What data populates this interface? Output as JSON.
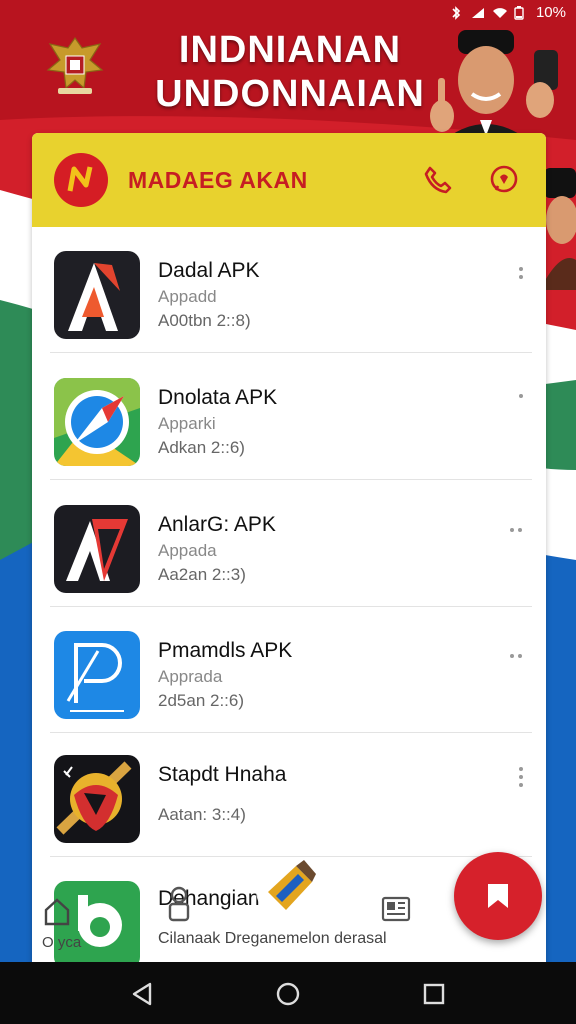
{
  "status_bar": {
    "battery": "10%"
  },
  "banner": {
    "title_line1": "INDNIANAN",
    "title_line2": "UNDONNAIAN"
  },
  "header": {
    "brand_title": "MADAEG AKAN",
    "brand_logo_letter": "N"
  },
  "apps": [
    {
      "name": "Dadal APK",
      "subtitle": "Appadd",
      "meta": "A00tbn 2::8)"
    },
    {
      "name": "Dnolata APK",
      "subtitle": "Apparki",
      "meta": "Adkan 2::6)"
    },
    {
      "name": "AnlarG: APK",
      "subtitle": "Appada",
      "meta": "Aa2an 2::3)"
    },
    {
      "name": "Pmamdls APK",
      "subtitle": "Apprada",
      "meta": "2d5an 2::6)"
    },
    {
      "name": "Stapdt Hnaha",
      "subtitle": "",
      "meta": "Aatan: 3::4)"
    },
    {
      "name": "Dehangian",
      "subtitle": "",
      "meta": ""
    }
  ],
  "bottom_bar": {
    "left_label": "O yca",
    "description": "Cilanaak Dreganemelon derasal"
  },
  "colors": {
    "header_yellow": "#e8d22e",
    "brand_red": "#c61d23",
    "fab_red": "#d6212b"
  }
}
